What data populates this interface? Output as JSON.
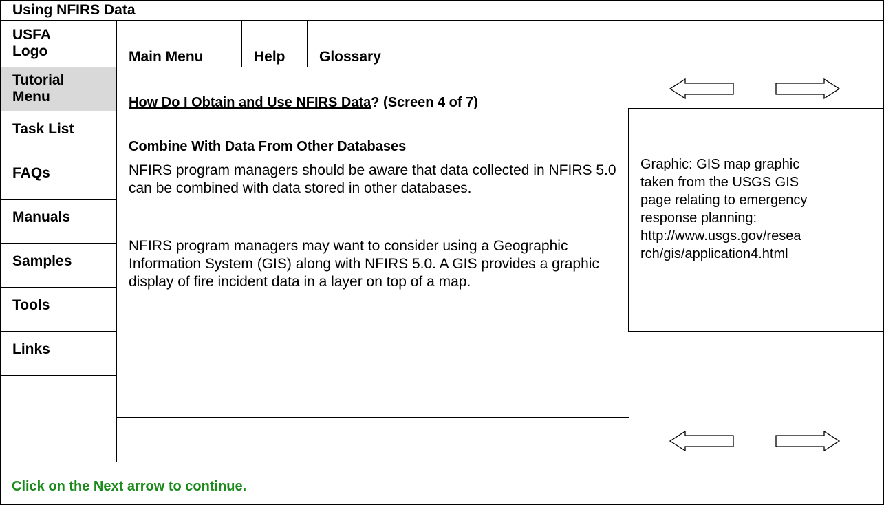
{
  "app": {
    "title": "Using NFIRS Data"
  },
  "header": {
    "logo_line1": "USFA",
    "logo_line2": "Logo",
    "nav": [
      {
        "label": "Main Menu"
      },
      {
        "label": "Help"
      },
      {
        "label": "Glossary"
      }
    ]
  },
  "sidebar": {
    "items": [
      {
        "label_line1": "Tutorial",
        "label_line2": "Menu",
        "active": true
      },
      {
        "label": "Task List"
      },
      {
        "label": "FAQs"
      },
      {
        "label": "Manuals"
      },
      {
        "label": "Samples"
      },
      {
        "label": "Tools"
      },
      {
        "label": "Links"
      }
    ]
  },
  "content": {
    "title_link": "How Do I Obtain and Use NFIRS Data",
    "title_suffix": "?  (Screen 4 of 7)",
    "section_heading": "Combine With Data From Other Databases",
    "paragraphs": [
      "NFIRS program managers should be aware that data collected in NFIRS 5.0 can be combined with data stored in other databases.",
      "NFIRS program managers may want to consider using a Geographic Information System (GIS) along with NFIRS 5.0.  A GIS provides a graphic display of fire incident data in a layer on top of a map."
    ]
  },
  "graphic": {
    "lines": [
      "Graphic:  GIS map graphic",
      "taken from the USGS GIS",
      "page relating to emergency",
      "response planning:",
      "http://www.usgs.gov/resea",
      "rch/gis/application4.html"
    ]
  },
  "navigation": {
    "back_icon": "left-arrow-outline",
    "next_icon": "right-arrow-outline"
  },
  "footer": {
    "status": "Click on the Next arrow to continue."
  },
  "colors": {
    "status_text": "#1a8a1a",
    "active_sidebar_bg": "#d9d9d9"
  }
}
